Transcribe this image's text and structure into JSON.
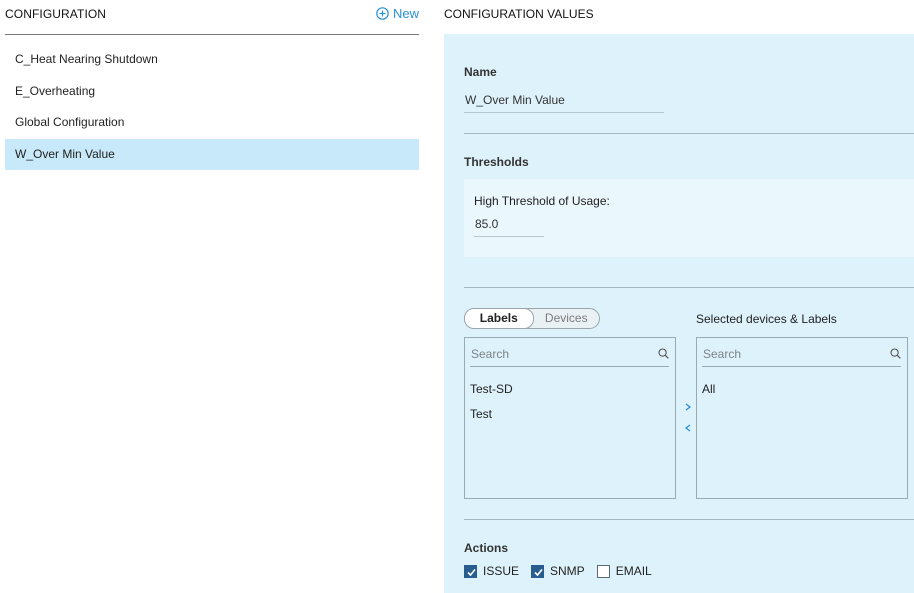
{
  "left": {
    "title": "CONFIGURATION",
    "new_label": "New",
    "items": [
      {
        "label": "C_Heat Nearing Shutdown",
        "selected": false
      },
      {
        "label": "E_Overheating",
        "selected": false
      },
      {
        "label": "Global Configuration",
        "selected": false
      },
      {
        "label": "W_Over Min Value",
        "selected": true
      }
    ]
  },
  "right": {
    "title": "CONFIGURATION VALUES",
    "name_section": {
      "label": "Name",
      "value": "W_Over Min Value"
    },
    "thresholds": {
      "label": "Thresholds",
      "field_label": "High Threshold of Usage:",
      "field_value": "85.0"
    },
    "toggle": {
      "labels": "Labels",
      "devices": "Devices",
      "active": "Labels"
    },
    "available": {
      "search_placeholder": "Search",
      "items": [
        "Test-SD",
        "Test"
      ]
    },
    "selected": {
      "title": "Selected devices & Labels",
      "search_placeholder": "Search",
      "items": [
        "All"
      ]
    },
    "actions": {
      "label": "Actions",
      "options": [
        {
          "label": "ISSUE",
          "checked": true
        },
        {
          "label": "SNMP",
          "checked": true
        },
        {
          "label": "EMAIL",
          "checked": false
        }
      ]
    }
  },
  "colors": {
    "accent": "#2a8fd6",
    "panel_bg": "#def2fb",
    "selected_row": "#c8e9f9",
    "checkbox": "#2a5d8f"
  },
  "icons": [
    "plus-circle-icon",
    "search-icon",
    "chevron-right-icon",
    "chevron-left-icon",
    "check-icon"
  ]
}
